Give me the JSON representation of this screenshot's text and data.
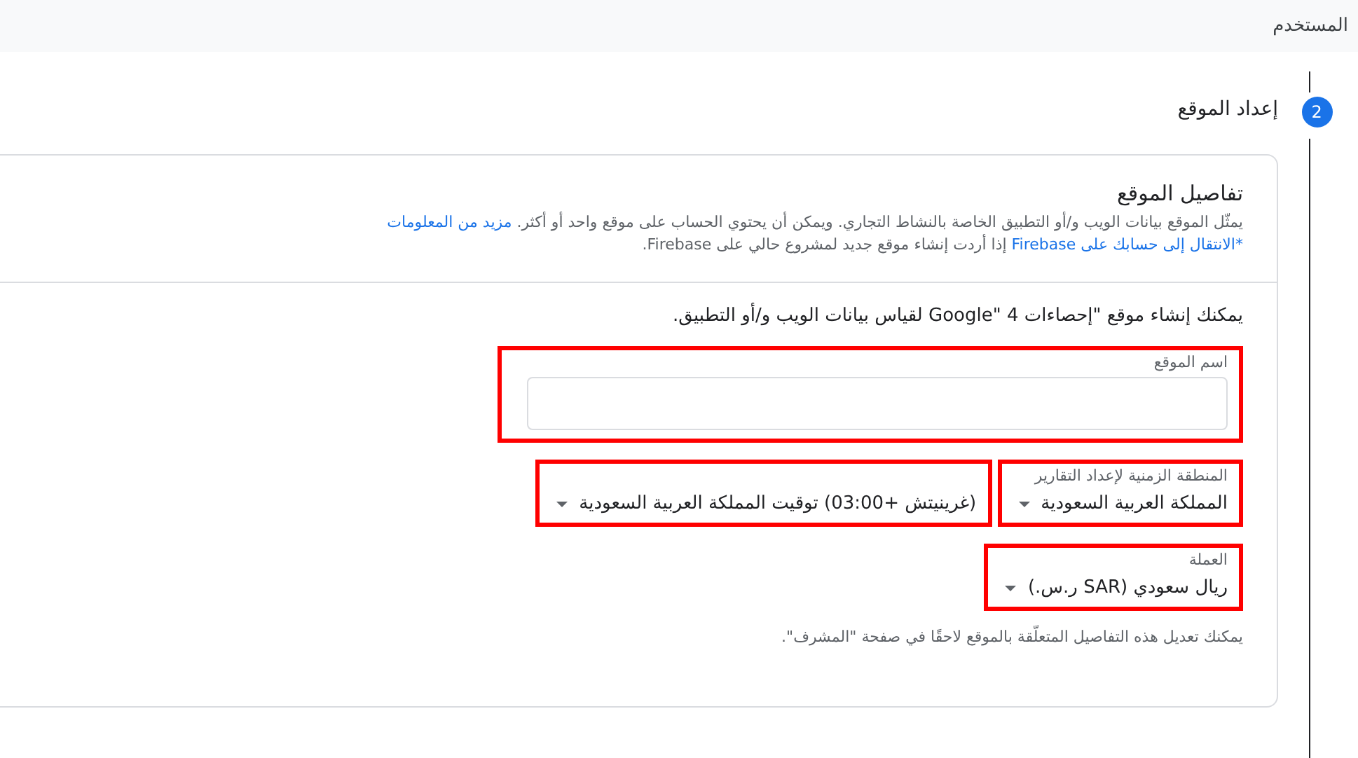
{
  "top_bar": {
    "title": "المستخدم"
  },
  "step": {
    "number": "2",
    "title": "إعداد الموقع",
    "active": true
  },
  "card": {
    "title": "تفاصيل الموقع",
    "description": [
      [
        {
          "text": "يمثّل الموقع بيانات الويب و/أو التطبيق الخاصة بالنشاط التجاري. ويمكن أن يحتوي الحساب على موقع واحد أو أكثر. "
        },
        {
          "link": "مزيد من المعلومات"
        }
      ],
      [
        {
          "link": "*الانتقال إلى حسابك على Firebase"
        },
        {
          "text": " إذا أردت إنشاء موقع جديد لمشروع حالي على Firebase."
        }
      ]
    ],
    "intro": "يمكنك إنشاء موقع \"إحصاءات Google\" 4 لقياس بيانات الويب و/أو التطبيق.",
    "field_rows": [
      [
        {
          "kind": "text",
          "label": "اسم الموقع",
          "highlighted": true
        }
      ],
      [
        {
          "kind": "select",
          "label": "المنطقة الزمنية لإعداد التقارير",
          "value": "المملكة العربية السعودية",
          "highlighted": true
        },
        {
          "kind": "select",
          "value": "(غرينيتش +03:00) توقيت المملكة العربية السعودية",
          "highlighted": true
        }
      ],
      [
        {
          "kind": "select",
          "label": "العملة",
          "value": "ريال سعودي (SAR ر.س.)",
          "highlighted": true
        }
      ]
    ],
    "note": "يمكنك تعديل هذه التفاصيل المتعلّقة بالموقع لاحقًا في صفحة \"المشرف\"."
  }
}
